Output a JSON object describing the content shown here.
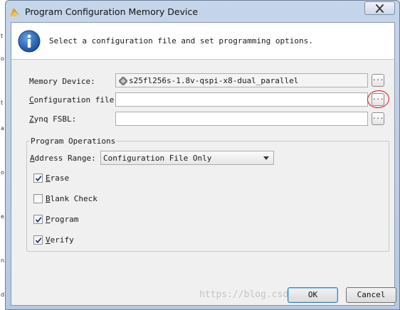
{
  "window": {
    "title": "Program Configuration Memory Device"
  },
  "header": {
    "text": "Select a configuration file and set programming options."
  },
  "memory_device": {
    "label": "Memory Device:",
    "value": "s25fl256s-1.8v-qspi-x8-dual_parallel",
    "browse": "..."
  },
  "configuration_file": {
    "label_mnemonic": "C",
    "label_rest": "onfiguration file:",
    "value": "",
    "browse": "..."
  },
  "zynq_fsbl": {
    "label_mnemonic": "Z",
    "label_rest": "ynq FSBL:",
    "value": "",
    "browse": "..."
  },
  "program_operations": {
    "title": "Program Operations",
    "address_range": {
      "label_mnemonic": "A",
      "label_rest": "ddress Range:",
      "selected": "Configuration File Only"
    },
    "options": [
      {
        "mnemonic": "E",
        "rest": "rase",
        "checked": true
      },
      {
        "mnemonic": "B",
        "rest": "lank Check",
        "checked": false
      },
      {
        "mnemonic": "P",
        "rest": "rogram",
        "checked": true
      },
      {
        "mnemonic": "V",
        "rest": "erify",
        "checked": true
      }
    ]
  },
  "buttons": {
    "ok": "OK",
    "cancel": "Cancel"
  },
  "background_strip": [
    "t",
    "o",
    "t",
    "a",
    "o",
    "e",
    "n",
    "d"
  ],
  "watermark": "https://blog.csdn.net/",
  "colors": {
    "annotation_circle": "#e0141e",
    "title_bar": "#c5d5ea"
  }
}
